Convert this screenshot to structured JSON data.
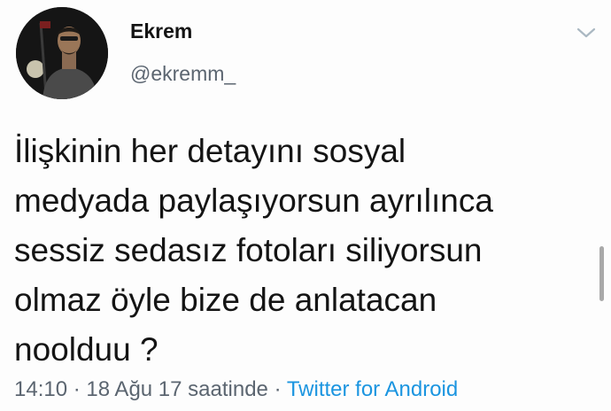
{
  "user": {
    "display_name": "Ekrem",
    "handle": "@ekremm_"
  },
  "tweet": {
    "text": "İlişkinin her detayını sosyal\nmedyada paylaşıyorsun ayrılınca\nsessiz sedasız fotoları siliyorsun\nolmaz öyle bize de anlatacan\nnoolduu ?",
    "time": "14:10",
    "separator": " · ",
    "date": "18 Ağu 17 saatinde",
    "source": "Twitter for Android"
  },
  "icons": {
    "menu": "chevron-down-icon",
    "avatar": "avatar"
  },
  "colors": {
    "text": "#141414",
    "secondary": "#5b6570",
    "link": "#1b95e0"
  }
}
